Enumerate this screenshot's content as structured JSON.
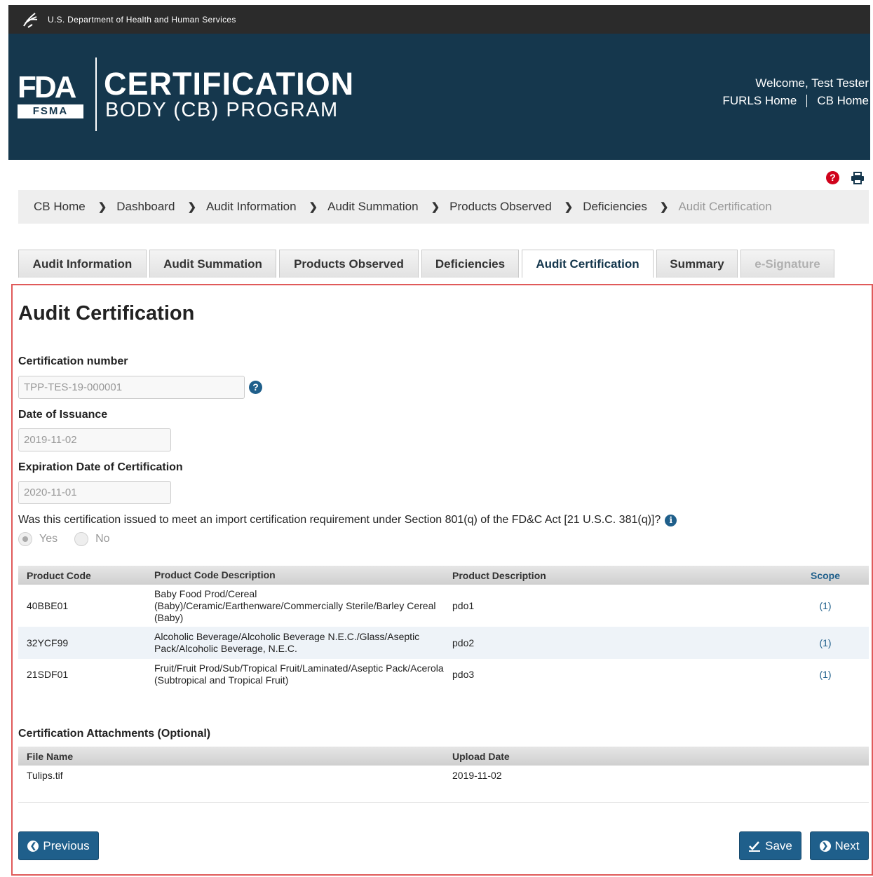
{
  "hhs_bar": {
    "text": "U.S. Department of Health and Human Services"
  },
  "header": {
    "logo_fda": "FDA",
    "logo_fsma": "FSMA",
    "title_line1": "CERTIFICATION",
    "title_line2": "BODY (CB) PROGRAM",
    "welcome": "Welcome, Test Tester",
    "links": [
      "FURLS Home",
      "CB Home"
    ]
  },
  "utility": {
    "help_icon": "help-icon",
    "print_icon": "print-icon"
  },
  "breadcrumb": {
    "items": [
      "CB Home",
      "Dashboard",
      "Audit Information",
      "Audit Summation",
      "Products Observed",
      "Deficiencies"
    ],
    "current": "Audit Certification"
  },
  "tabs": [
    {
      "label": "Audit Information",
      "state": "default"
    },
    {
      "label": "Audit Summation",
      "state": "default"
    },
    {
      "label": "Products Observed",
      "state": "default"
    },
    {
      "label": "Deficiencies",
      "state": "default"
    },
    {
      "label": "Audit Certification",
      "state": "active"
    },
    {
      "label": "Summary",
      "state": "default"
    },
    {
      "label": "e-Signature",
      "state": "disabled"
    }
  ],
  "form": {
    "title": "Audit Certification",
    "cert_number_label": "Certification number",
    "cert_number_value": "TPP-TES-19-000001",
    "issue_date_label": "Date of Issuance",
    "issue_date_value": "2019-11-02",
    "expiry_label": "Expiration Date of Certification",
    "expiry_value": "2020-11-01",
    "question": "Was this certification issued to meet an import certification requirement under Section 801(q) of the FD&C Act [21 U.S.C. 381(q)]?",
    "radio_yes": "Yes",
    "radio_no": "No",
    "selected": "Yes"
  },
  "products_table": {
    "headers": [
      "Product Code",
      "Product Code Description",
      "Product Description",
      "Scope"
    ],
    "rows": [
      {
        "code": "40BBE01",
        "code_desc": "Baby Food Prod/Cereal (Baby)/Ceramic/Earthenware/Commercially Sterile/Barley Cereal (Baby)",
        "prod_desc": "pdo1",
        "scope": "(1)"
      },
      {
        "code": "32YCF99",
        "code_desc": "Alcoholic Beverage/Alcoholic Beverage N.E.C./Glass/Aseptic Pack/Alcoholic Beverage, N.E.C.",
        "prod_desc": "pdo2",
        "scope": "(1)"
      },
      {
        "code": "21SDF01",
        "code_desc": "Fruit/Fruit Prod/Sub/Tropical Fruit/Laminated/Aseptic Pack/Acerola (Subtropical and Tropical Fruit)",
        "prod_desc": "pdo3",
        "scope": "(1)"
      }
    ]
  },
  "attachments": {
    "label": "Certification Attachments (Optional)",
    "headers": [
      "File Name",
      "Upload Date"
    ],
    "rows": [
      {
        "file": "Tulips.tif",
        "date": "2019-11-02"
      }
    ]
  },
  "buttons": {
    "previous": "Previous",
    "save": "Save",
    "next": "Next"
  }
}
